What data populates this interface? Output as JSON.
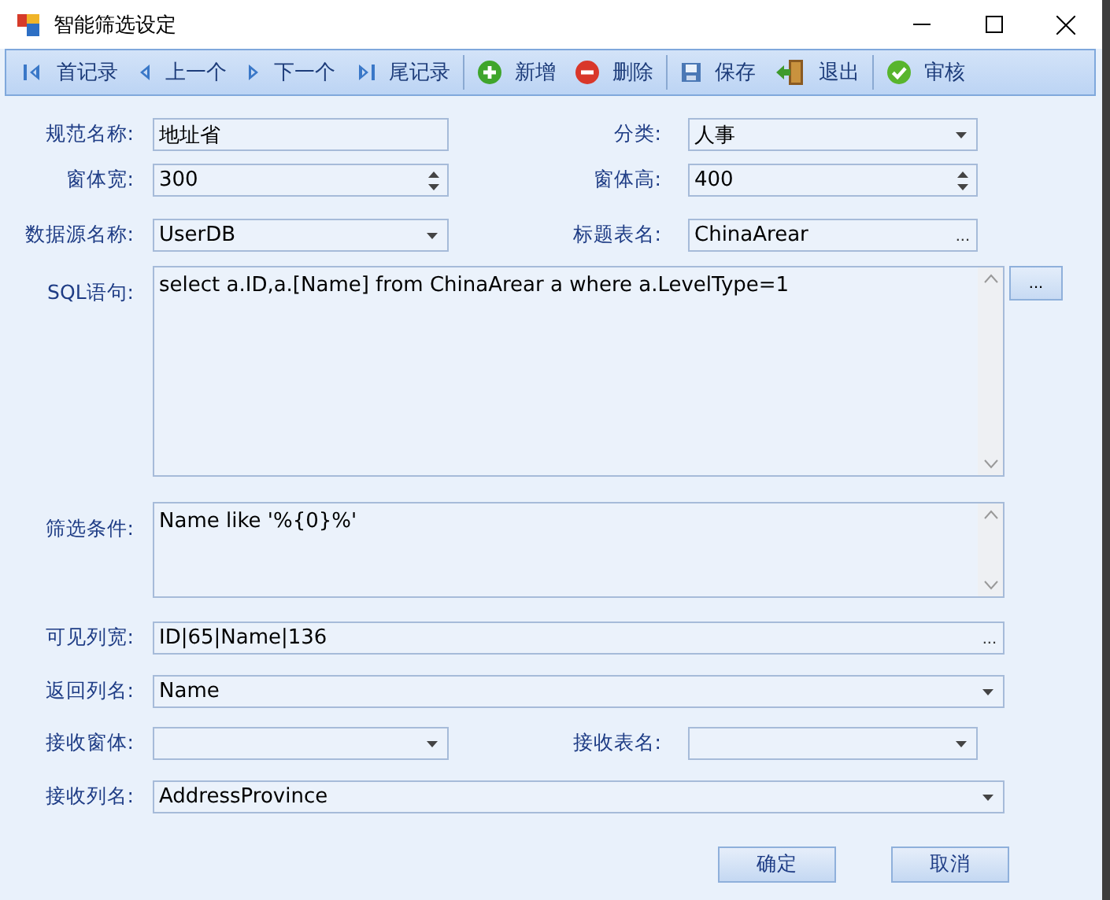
{
  "window": {
    "title": "智能筛选设定"
  },
  "toolbar": {
    "groups": [
      [
        {
          "label": "首记录",
          "kind": "first"
        },
        {
          "label": "上一个",
          "kind": "prev"
        },
        {
          "label": "下一个",
          "kind": "next"
        },
        {
          "label": "尾记录",
          "kind": "last"
        }
      ],
      [
        {
          "label": "新增",
          "kind": "add"
        },
        {
          "label": "删除",
          "kind": "delete"
        }
      ],
      [
        {
          "label": "保存",
          "kind": "save"
        },
        {
          "label": "退出",
          "kind": "exit"
        }
      ],
      [
        {
          "label": "审核",
          "kind": "approve"
        }
      ]
    ]
  },
  "form": {
    "rows": [
      [
        {
          "label": "规范名称:",
          "kind": "text",
          "value": "地址省"
        },
        {
          "label": "分类:",
          "kind": "combo",
          "value": "人事"
        }
      ],
      [
        {
          "label": "窗体宽:",
          "kind": "spin",
          "value": "300"
        },
        {
          "label": "窗体高:",
          "kind": "spin",
          "value": "400"
        }
      ],
      [
        {
          "label": "数据源名称:",
          "kind": "combo",
          "value": "UserDB"
        },
        {
          "label": "标题表名:",
          "kind": "ellipsis",
          "value": "ChinaArear",
          "button": "..."
        }
      ],
      [
        {
          "label": "SQL语句:",
          "kind": "memo",
          "value": "select a.ID,a.[Name] from ChinaArear a where a.LevelType=1",
          "button": "..."
        }
      ],
      [
        {
          "label": "筛选条件:",
          "kind": "memo",
          "value": "Name like '%{0}%'"
        }
      ],
      [
        {
          "label": "可见列宽:",
          "kind": "ellipsis",
          "value": "ID|65|Name|136",
          "button": "..."
        }
      ],
      [
        {
          "label": "返回列名:",
          "kind": "combo",
          "value": "Name"
        }
      ],
      [
        {
          "label": "接收窗体:",
          "kind": "combo"
        },
        {
          "label": "接收表名:",
          "kind": "combo"
        }
      ],
      [
        {
          "label": "接收列名:",
          "kind": "combo",
          "value": "AddressProvince"
        }
      ]
    ]
  },
  "buttons": [
    "确定",
    "取消"
  ]
}
